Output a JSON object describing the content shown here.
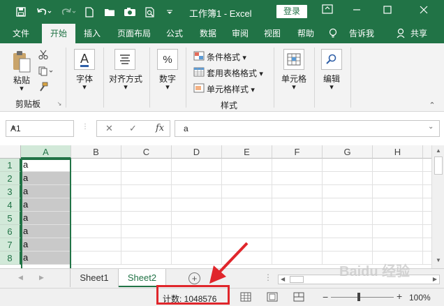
{
  "titlebar": {
    "title": "工作簿1 - Excel",
    "login": "登录",
    "bg_color": "#217346"
  },
  "tabs": [
    "文件",
    "开始",
    "插入",
    "页面布局",
    "公式",
    "数据",
    "审阅",
    "视图",
    "帮助",
    "告诉我",
    "共享"
  ],
  "ribbon": {
    "paste": "粘贴",
    "clipboard": "剪贴板",
    "font": "字体",
    "font_icon_letter": "A",
    "align": "对齐方式",
    "number": "数字",
    "number_icon": "%",
    "cond_format": "条件格式",
    "table_format": "套用表格格式",
    "cell_style": "单元格样式",
    "styles": "样式",
    "cells": "单元格",
    "edit": "编辑"
  },
  "formula_bar": {
    "name_box": "A1",
    "fx": "fx",
    "value": "a"
  },
  "grid": {
    "columns": [
      "A",
      "B",
      "C",
      "D",
      "E",
      "F",
      "G",
      "H"
    ],
    "rows": [
      "1",
      "2",
      "3",
      "4",
      "5",
      "6",
      "7",
      "8"
    ],
    "column_a_values": [
      "a",
      "a",
      "a",
      "a",
      "a",
      "a",
      "a",
      "a"
    ],
    "selected_column": "A"
  },
  "sheets": {
    "tabs": [
      "Sheet1",
      "Sheet2"
    ],
    "active": "Sheet2"
  },
  "statusbar": {
    "count_text": "计数: 1048576",
    "zoom": "100%"
  },
  "watermark": "Baidu 经验",
  "annotation_color": "#e0262b"
}
